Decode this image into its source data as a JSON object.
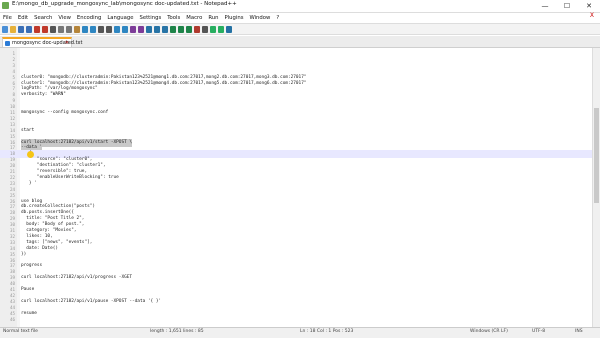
{
  "window": {
    "title": "E:\\mongo_db_upgrade_mongosync_lab\\mongosync doc-updated.txt - Notepad++",
    "minimize_glyph": "—",
    "maximize_glyph": "☐",
    "close_glyph": "✕"
  },
  "menu": {
    "items": [
      "File",
      "Edit",
      "Search",
      "View",
      "Encoding",
      "Language",
      "Settings",
      "Tools",
      "Macro",
      "Run",
      "Plugins",
      "Window",
      "?"
    ],
    "close_glyph": "X"
  },
  "tab": {
    "label": "mongosync doc-updated.txt",
    "close_glyph": "✕"
  },
  "editor": {
    "lines": [
      {
        "num": "1",
        "text": ""
      },
      {
        "num": "2",
        "text": ""
      },
      {
        "num": "3",
        "text": ""
      },
      {
        "num": "4",
        "text": ""
      },
      {
        "num": "5",
        "text": "cluster0: \"mongodb://clusteradmin:Pakistan123%2521@mong1.db.com:27017,mong2.db.com:27017,mong3.db.com:27017\""
      },
      {
        "num": "6",
        "text": "cluster1: \"mongodb://clusteradmin:Pakistan123%2521@mong4.db.com:27017,mong5.db.com:27017,mong6.db.com:27017\""
      },
      {
        "num": "7",
        "text": "logPath: \"/var/log/mongosync\""
      },
      {
        "num": "8",
        "text": "verbosity: \"WARN\""
      },
      {
        "num": "9",
        "text": ""
      },
      {
        "num": "10",
        "text": ""
      },
      {
        "num": "11",
        "text": "mongosync --config mongosync.conf"
      },
      {
        "num": "12",
        "text": ""
      },
      {
        "num": "13",
        "text": ""
      },
      {
        "num": "14",
        "text": "start"
      },
      {
        "num": "15",
        "text": ""
      },
      {
        "num": "16",
        "text": "curl localhost:27182/api/v1/start -XPOST \\"
      },
      {
        "num": "17",
        "text": "--data '"
      },
      {
        "num": "18",
        "text": "   {"
      },
      {
        "num": "19",
        "text": "      \"source\": \"cluster0\","
      },
      {
        "num": "20",
        "text": "      \"destination\": \"cluster1\","
      },
      {
        "num": "21",
        "text": "      \"reversible\": true,"
      },
      {
        "num": "22",
        "text": "      \"enableUserWriteBlocking\": true"
      },
      {
        "num": "23",
        "text": "   } '"
      },
      {
        "num": "24",
        "text": ""
      },
      {
        "num": "25",
        "text": ""
      },
      {
        "num": "26",
        "text": "use blog"
      },
      {
        "num": "27",
        "text": "db.createCollection(\"posts\")"
      },
      {
        "num": "28",
        "text": "db.posts.insertOne({"
      },
      {
        "num": "29",
        "text": "  title: \"Post Title 2\","
      },
      {
        "num": "30",
        "text": "  body: \"Body of post.\","
      },
      {
        "num": "31",
        "text": "  category: \"Movies\","
      },
      {
        "num": "32",
        "text": "  likes: 10,"
      },
      {
        "num": "33",
        "text": "  tags: [\"news\", \"events\"],"
      },
      {
        "num": "34",
        "text": "  date: Date()"
      },
      {
        "num": "35",
        "text": "})"
      },
      {
        "num": "36",
        "text": ""
      },
      {
        "num": "37",
        "text": "progress"
      },
      {
        "num": "38",
        "text": ""
      },
      {
        "num": "39",
        "text": "curl localhost:27182/api/v1/progress -XGET"
      },
      {
        "num": "40",
        "text": ""
      },
      {
        "num": "41",
        "text": "Pause"
      },
      {
        "num": "42",
        "text": ""
      },
      {
        "num": "43",
        "text": "curl localhost:27182/api/v1/pause -XPOST --data '{ }'"
      },
      {
        "num": "44",
        "text": ""
      },
      {
        "num": "45",
        "text": "resume"
      },
      {
        "num": "46",
        "text": ""
      }
    ],
    "selected_lines": [
      16,
      17
    ],
    "current_line": 18
  },
  "status": {
    "left": "Normal text file",
    "middle": "length : 1,651   lines : 85",
    "position": "Ln : 18   Col : 1   Pos : 523",
    "eol": "Windows (CR LF)",
    "encoding": "UTF-8",
    "mode": "INS"
  },
  "colors": {
    "tab_accent": "#f5a623",
    "selection": "#c8c8c8",
    "current_line": "#e8e8ff",
    "cursor_highlight": "#f5c518"
  }
}
